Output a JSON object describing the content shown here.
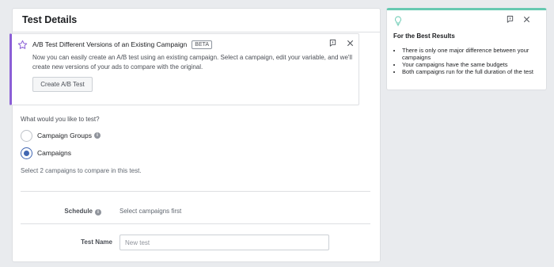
{
  "main": {
    "title": "Test Details",
    "promo": {
      "title": "A/B Test Different Versions of an Existing Campaign",
      "badge": "BETA",
      "description": "Now you can easily create an A/B test using an existing campaign. Select a campaign, edit your variable, and we'll create new versions of your ads to compare with the original.",
      "button_label": "Create A/B Test"
    },
    "question": "What would you like to test?",
    "options": [
      {
        "label": "Campaign Groups",
        "checked": false
      },
      {
        "label": "Campaigns",
        "checked": true
      }
    ],
    "hint": "Select 2 campaigns to compare in this test.",
    "schedule": {
      "label": "Schedule",
      "value": "Select campaigns first"
    },
    "test_name": {
      "label": "Test Name",
      "placeholder": "New test",
      "value": ""
    }
  },
  "sidebar": {
    "title": "For the Best Results",
    "tips": [
      "There is only one major difference between your campaigns",
      "Your campaigns have the same budgets",
      "Both campaigns run for the full duration of the test"
    ]
  },
  "colors": {
    "accent": "#8b5fd6",
    "primary": "#4267b2",
    "tip_accent": "#67c9b1"
  }
}
